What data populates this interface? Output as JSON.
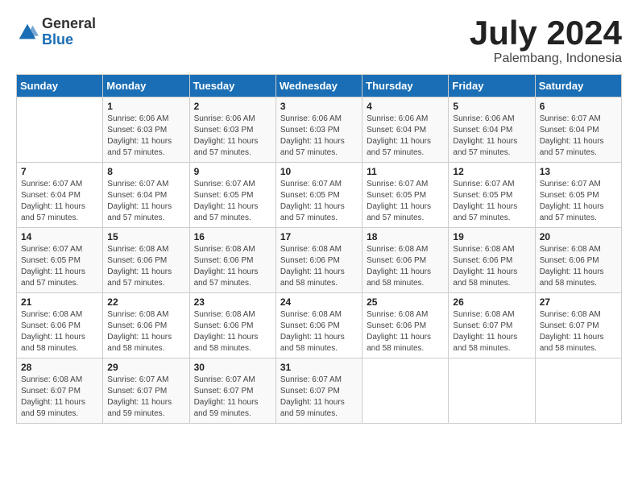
{
  "header": {
    "logo_general": "General",
    "logo_blue": "Blue",
    "month_year": "July 2024",
    "location": "Palembang, Indonesia"
  },
  "days_of_week": [
    "Sunday",
    "Monday",
    "Tuesday",
    "Wednesday",
    "Thursday",
    "Friday",
    "Saturday"
  ],
  "weeks": [
    [
      {
        "day": "",
        "info": ""
      },
      {
        "day": "1",
        "info": "Sunrise: 6:06 AM\nSunset: 6:03 PM\nDaylight: 11 hours\nand 57 minutes."
      },
      {
        "day": "2",
        "info": "Sunrise: 6:06 AM\nSunset: 6:03 PM\nDaylight: 11 hours\nand 57 minutes."
      },
      {
        "day": "3",
        "info": "Sunrise: 6:06 AM\nSunset: 6:03 PM\nDaylight: 11 hours\nand 57 minutes."
      },
      {
        "day": "4",
        "info": "Sunrise: 6:06 AM\nSunset: 6:04 PM\nDaylight: 11 hours\nand 57 minutes."
      },
      {
        "day": "5",
        "info": "Sunrise: 6:06 AM\nSunset: 6:04 PM\nDaylight: 11 hours\nand 57 minutes."
      },
      {
        "day": "6",
        "info": "Sunrise: 6:07 AM\nSunset: 6:04 PM\nDaylight: 11 hours\nand 57 minutes."
      }
    ],
    [
      {
        "day": "7",
        "info": "Sunrise: 6:07 AM\nSunset: 6:04 PM\nDaylight: 11 hours\nand 57 minutes."
      },
      {
        "day": "8",
        "info": "Sunrise: 6:07 AM\nSunset: 6:04 PM\nDaylight: 11 hours\nand 57 minutes."
      },
      {
        "day": "9",
        "info": "Sunrise: 6:07 AM\nSunset: 6:05 PM\nDaylight: 11 hours\nand 57 minutes."
      },
      {
        "day": "10",
        "info": "Sunrise: 6:07 AM\nSunset: 6:05 PM\nDaylight: 11 hours\nand 57 minutes."
      },
      {
        "day": "11",
        "info": "Sunrise: 6:07 AM\nSunset: 6:05 PM\nDaylight: 11 hours\nand 57 minutes."
      },
      {
        "day": "12",
        "info": "Sunrise: 6:07 AM\nSunset: 6:05 PM\nDaylight: 11 hours\nand 57 minutes."
      },
      {
        "day": "13",
        "info": "Sunrise: 6:07 AM\nSunset: 6:05 PM\nDaylight: 11 hours\nand 57 minutes."
      }
    ],
    [
      {
        "day": "14",
        "info": "Sunrise: 6:07 AM\nSunset: 6:05 PM\nDaylight: 11 hours\nand 57 minutes."
      },
      {
        "day": "15",
        "info": "Sunrise: 6:08 AM\nSunset: 6:06 PM\nDaylight: 11 hours\nand 57 minutes."
      },
      {
        "day": "16",
        "info": "Sunrise: 6:08 AM\nSunset: 6:06 PM\nDaylight: 11 hours\nand 57 minutes."
      },
      {
        "day": "17",
        "info": "Sunrise: 6:08 AM\nSunset: 6:06 PM\nDaylight: 11 hours\nand 58 minutes."
      },
      {
        "day": "18",
        "info": "Sunrise: 6:08 AM\nSunset: 6:06 PM\nDaylight: 11 hours\nand 58 minutes."
      },
      {
        "day": "19",
        "info": "Sunrise: 6:08 AM\nSunset: 6:06 PM\nDaylight: 11 hours\nand 58 minutes."
      },
      {
        "day": "20",
        "info": "Sunrise: 6:08 AM\nSunset: 6:06 PM\nDaylight: 11 hours\nand 58 minutes."
      }
    ],
    [
      {
        "day": "21",
        "info": "Sunrise: 6:08 AM\nSunset: 6:06 PM\nDaylight: 11 hours\nand 58 minutes."
      },
      {
        "day": "22",
        "info": "Sunrise: 6:08 AM\nSunset: 6:06 PM\nDaylight: 11 hours\nand 58 minutes."
      },
      {
        "day": "23",
        "info": "Sunrise: 6:08 AM\nSunset: 6:06 PM\nDaylight: 11 hours\nand 58 minutes."
      },
      {
        "day": "24",
        "info": "Sunrise: 6:08 AM\nSunset: 6:06 PM\nDaylight: 11 hours\nand 58 minutes."
      },
      {
        "day": "25",
        "info": "Sunrise: 6:08 AM\nSunset: 6:06 PM\nDaylight: 11 hours\nand 58 minutes."
      },
      {
        "day": "26",
        "info": "Sunrise: 6:08 AM\nSunset: 6:07 PM\nDaylight: 11 hours\nand 58 minutes."
      },
      {
        "day": "27",
        "info": "Sunrise: 6:08 AM\nSunset: 6:07 PM\nDaylight: 11 hours\nand 58 minutes."
      }
    ],
    [
      {
        "day": "28",
        "info": "Sunrise: 6:08 AM\nSunset: 6:07 PM\nDaylight: 11 hours\nand 59 minutes."
      },
      {
        "day": "29",
        "info": "Sunrise: 6:07 AM\nSunset: 6:07 PM\nDaylight: 11 hours\nand 59 minutes."
      },
      {
        "day": "30",
        "info": "Sunrise: 6:07 AM\nSunset: 6:07 PM\nDaylight: 11 hours\nand 59 minutes."
      },
      {
        "day": "31",
        "info": "Sunrise: 6:07 AM\nSunset: 6:07 PM\nDaylight: 11 hours\nand 59 minutes."
      },
      {
        "day": "",
        "info": ""
      },
      {
        "day": "",
        "info": ""
      },
      {
        "day": "",
        "info": ""
      }
    ]
  ]
}
